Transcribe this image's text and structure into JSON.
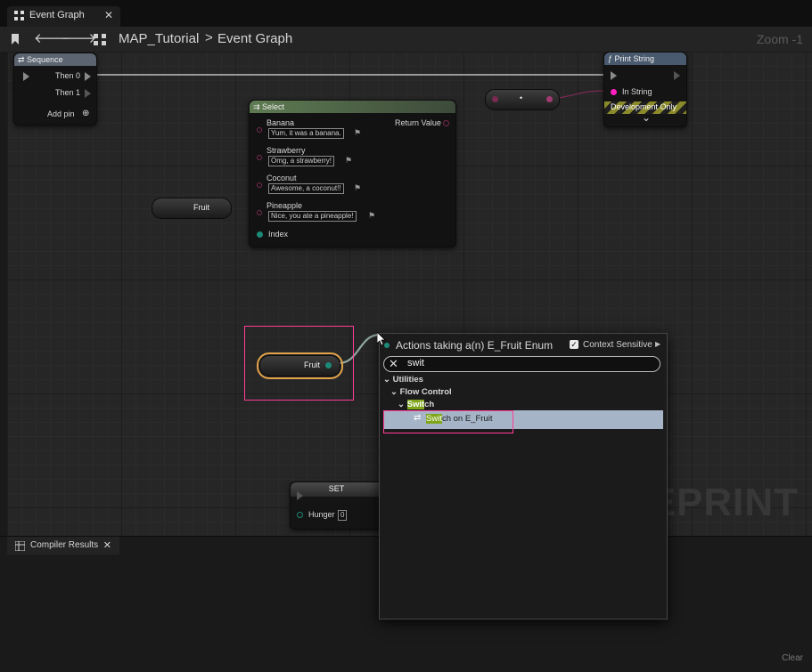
{
  "tab": {
    "title": "Event Graph",
    "close": "✕"
  },
  "toolbar": {
    "crumb_root": "MAP_Tutorial",
    "crumb_sep": ">",
    "crumb_current": "Event Graph",
    "zoom": "Zoom -1"
  },
  "nodes": {
    "sequence": {
      "title": "Sequence",
      "then0": "Then 0",
      "then1": "Then 1",
      "add_pin": "Add pin"
    },
    "print_string": {
      "title": "Print String",
      "in_string": "In String",
      "dev_only": "Development Only",
      "expand": "⌄"
    },
    "select": {
      "title": "Select",
      "return_value": "Return Value",
      "options": [
        {
          "label": "Banana",
          "value": "Yum, it was a banana."
        },
        {
          "label": "Strawberry",
          "value": "Omg, a strawberry!"
        },
        {
          "label": "Coconut",
          "value": "Awesome, a coconut!!"
        },
        {
          "label": "Pineapple",
          "value": "Nice, you ate a pineapple!"
        }
      ],
      "index": "Index"
    },
    "reroute_mid": {
      "label": "•"
    },
    "fruit_var_top": {
      "label": "Fruit"
    },
    "fruit_var_selected": {
      "label": "Fruit"
    },
    "set": {
      "title": "SET",
      "hunger": "Hunger",
      "hunger_value": "0"
    }
  },
  "watermark": "EPRINT",
  "menu": {
    "title": "Actions taking a(n) E_Fruit Enum",
    "context_sensitive": "Context Sensitive",
    "context_checked": "✓",
    "search_value": "swit",
    "clear_icon": "✕",
    "tree": {
      "utilities": "Utilities",
      "flow_control": "Flow Control",
      "switch_match": "Swit",
      "switch_rest": "ch",
      "item_match": "Swit",
      "item_rest": "ch on E_Fruit"
    }
  },
  "compiler": {
    "title": "Compiler Results",
    "close": "✕",
    "clear": "Clear"
  },
  "colors": {
    "accent_pink": "#ff3d97",
    "selection": "#a5b4c7",
    "match": "#7fa61b",
    "select_header": "#5e7b52",
    "print_header": "#4a5a6e"
  }
}
